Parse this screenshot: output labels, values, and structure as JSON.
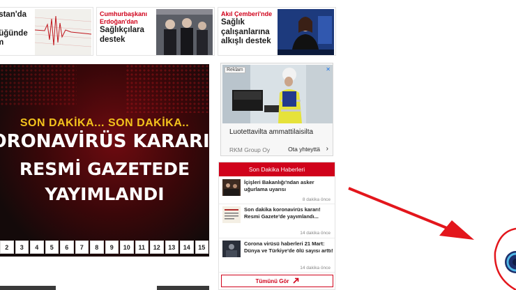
{
  "top_cards": [
    {
      "kicker": "",
      "lines": [
        "istan'da",
        "",
        "lüğünde",
        "m"
      ]
    },
    {
      "kicker": "Cumhurbaşkanı Erdoğan'dan",
      "lines": [
        "Sağlıkçılara",
        "destek"
      ]
    },
    {
      "kicker": "Akıl Çemberi'nde",
      "lines": [
        "Sağlık",
        "çalışanlarına",
        "alkışlı destek"
      ]
    }
  ],
  "banner": {
    "kicker": "SON DAKİKA... SON DAKİKA..",
    "line1": "ORONAVİRÜS KARARI!",
    "line2": "RESMİ GAZETEDE",
    "line3": "YAYIMLANDI"
  },
  "pager": [
    "2",
    "3",
    "4",
    "5",
    "6",
    "7",
    "8",
    "9",
    "10",
    "11",
    "12",
    "13",
    "14",
    "15"
  ],
  "ad": {
    "tag": "Reklam",
    "close": "✕",
    "title": "Luotettavilta ammattilaisilta",
    "sponsor": "RKM Group Oy",
    "cta": "Ota yhteyttä",
    "chevron": "›"
  },
  "son_dakika": {
    "header": "Son Dakika Haberleri",
    "items": [
      {
        "title": "İçişleri Bakanlığı'ndan asker uğurlama uyarısı",
        "time": "8 dakika önce"
      },
      {
        "title": "Son dakika koronavirüs kararı! Resmi Gazete'de yayımlandı...",
        "time": "14 dakika önce"
      },
      {
        "title": "Corona virüsü haberleri 21 Mart: Dünya ve Türkiye'de ölü sayısı arttı!",
        "time": "14 dakika önce"
      }
    ],
    "more": "Tümünü Gör",
    "more_icon": "arrow-up-right-icon"
  },
  "colors": {
    "brand_red": "#d0021b",
    "accent_yellow": "#f3c21c"
  }
}
